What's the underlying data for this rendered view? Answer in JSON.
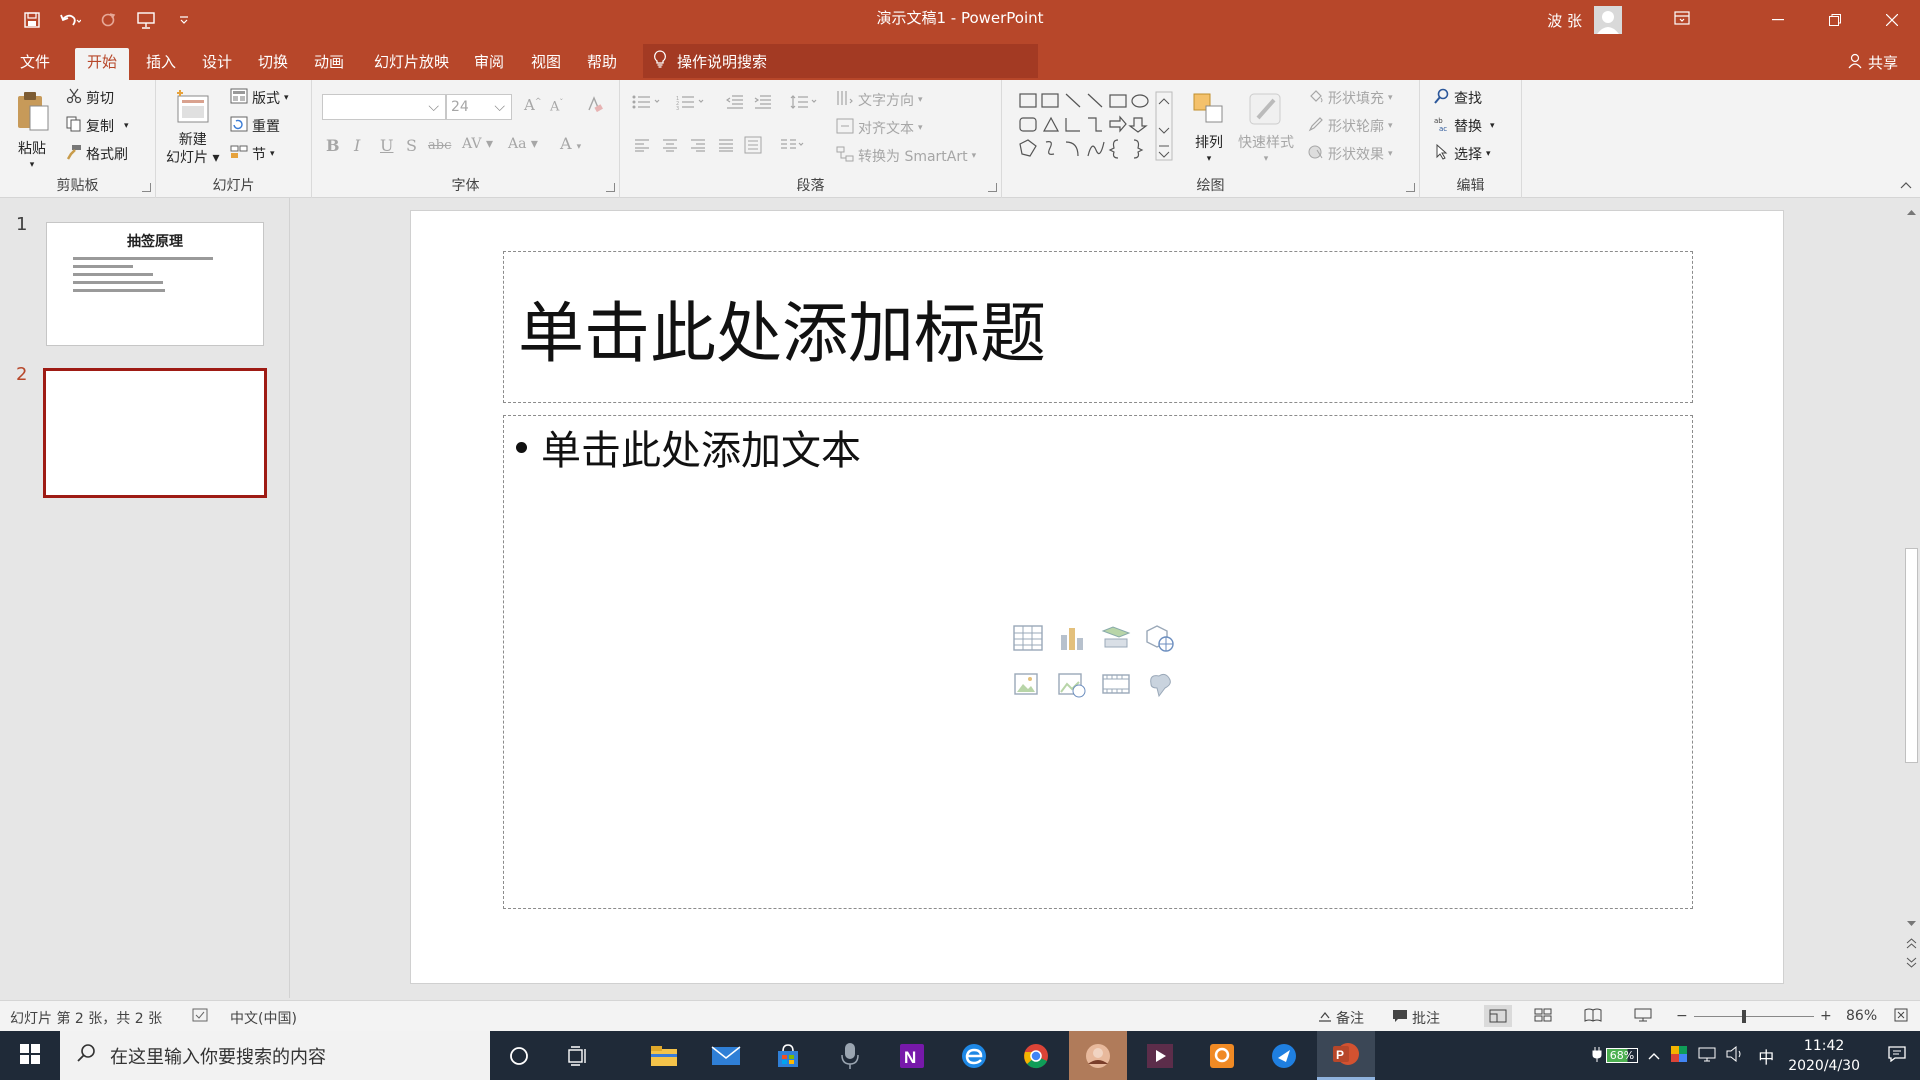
{
  "window": {
    "title": "演示文稿1 - PowerPoint",
    "user_name": "波 张"
  },
  "tabs": [
    "文件",
    "开始",
    "插入",
    "设计",
    "切换",
    "动画",
    "幻灯片放映",
    "审阅",
    "视图",
    "帮助"
  ],
  "active_tab": "开始",
  "tell_me": "操作说明搜索",
  "share": "共享",
  "ribbon": {
    "clipboard": {
      "label": "剪贴板",
      "paste": "粘贴",
      "cut": "剪切",
      "copy": "复制",
      "format_painter": "格式刷"
    },
    "slides": {
      "label": "幻灯片",
      "new_slide_1": "新建",
      "new_slide_2": "幻灯片",
      "layout": "版式",
      "reset": "重置",
      "section": "节"
    },
    "font": {
      "label": "字体",
      "font_size": "24"
    },
    "paragraph": {
      "label": "段落",
      "text_direction": "文字方向",
      "align_text": "对齐文本",
      "smartart": "转换为 SmartArt"
    },
    "drawing": {
      "label": "绘图",
      "arrange": "排列",
      "quick_styles": "快速样式",
      "shape_fill": "形状填充",
      "shape_outline": "形状轮廓",
      "shape_effects": "形状效果"
    },
    "editing": {
      "label": "编辑",
      "find": "查找",
      "replace": "替换",
      "select": "选择"
    }
  },
  "thumbnails": [
    {
      "number": "1",
      "title": "抽签原理"
    },
    {
      "number": "2",
      "title": ""
    }
  ],
  "slide": {
    "title_placeholder": "单击此处添加标题",
    "body_placeholder": "单击此处添加文本"
  },
  "statusbar": {
    "slide_info": "幻灯片 第 2 张，共 2 张",
    "language": "中文(中国)",
    "notes": "备注",
    "comments": "批注",
    "zoom": "86%"
  },
  "taskbar": {
    "search_placeholder": "在这里输入你要搜索的内容",
    "battery": "68%",
    "ime": "中",
    "time": "11:42",
    "date": "2020/4/30"
  },
  "colors": {
    "accent": "#b7472a",
    "selected_thumb": "#9e1b14"
  }
}
